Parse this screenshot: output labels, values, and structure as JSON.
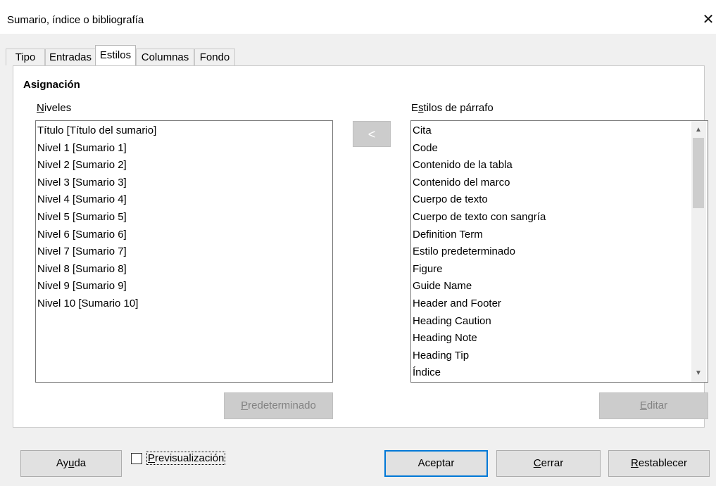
{
  "window": {
    "title": "Sumario, índice o bibliografía",
    "close_glyph": "✕"
  },
  "tabs": [
    {
      "label": "Tipo"
    },
    {
      "label": "Entradas"
    },
    {
      "label": "Estilos"
    },
    {
      "label": "Columnas"
    },
    {
      "label": "Fondo"
    }
  ],
  "active_tab": "Estilos",
  "section": {
    "heading": "Asignación"
  },
  "levels": {
    "label_u": "N",
    "label_rest": "iveles",
    "items": [
      "Título [Título del sumario]",
      "Nivel 1 [Sumario 1]",
      "Nivel 2 [Sumario 2]",
      "Nivel 3 [Sumario 3]",
      "Nivel 4 [Sumario 4]",
      "Nivel 5 [Sumario 5]",
      "Nivel 6 [Sumario 6]",
      "Nivel 7 [Sumario 7]",
      "Nivel 8 [Sumario 8]",
      "Nivel 9 [Sumario 9]",
      "Nivel 10 [Sumario 10]"
    ]
  },
  "paragraph_styles": {
    "label_pre": "E",
    "label_u": "s",
    "label_rest": "tilos de párrafo",
    "items": [
      "Cita",
      "Code",
      "Contenido de la tabla",
      "Contenido del marco",
      "Cuerpo de texto",
      "Cuerpo de texto con sangría",
      "Definition Term",
      "Estilo predeterminado",
      "Figure",
      "Guide Name",
      "Header and Footer",
      "Heading Caution",
      "Heading Note",
      "Heading Tip",
      "Índice"
    ]
  },
  "assign_button": {
    "glyph": "<"
  },
  "buttons": {
    "default_u": "P",
    "default_rest": "redeterminado",
    "edit_u": "E",
    "edit_rest": "ditar",
    "help_pre": "Ay",
    "help_u": "u",
    "help_rest": "da",
    "ok": "Aceptar",
    "close_u": "C",
    "close_rest": "errar",
    "reset_u": "R",
    "reset_rest": "establecer"
  },
  "preview": {
    "u": "P",
    "rest": "revisualización",
    "checked": false
  },
  "scroll_arrows": {
    "up": "▲",
    "down": "▼"
  }
}
